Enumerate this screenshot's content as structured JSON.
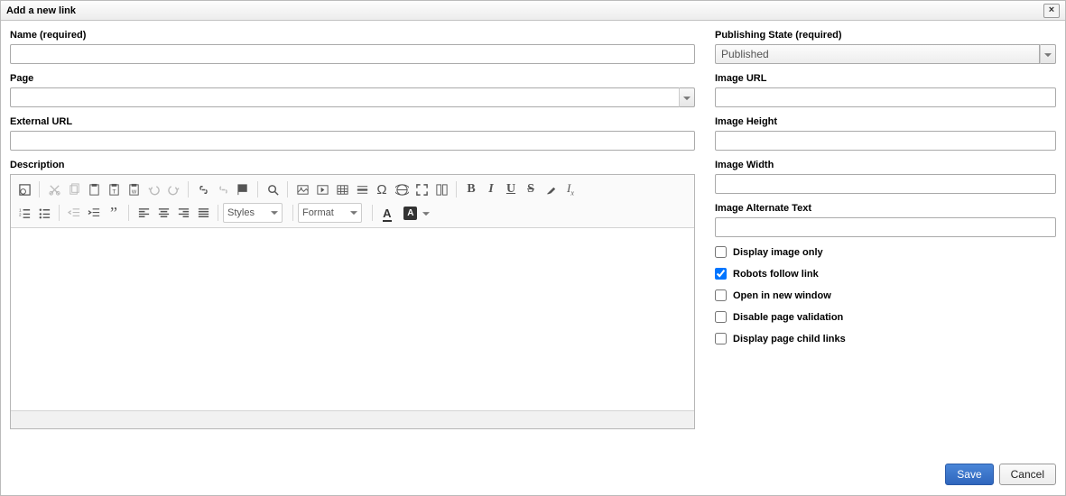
{
  "dialog": {
    "title": "Add a new link",
    "close": "×"
  },
  "left": {
    "name_label": "Name (required)",
    "name_value": "",
    "page_label": "Page",
    "page_value": "",
    "exturl_label": "External URL",
    "exturl_value": "",
    "desc_label": "Description"
  },
  "editor": {
    "styles_label": "Styles",
    "format_label": "Format"
  },
  "right": {
    "pubstate_label": "Publishing State (required)",
    "pubstate_value": "Published",
    "imgurl_label": "Image URL",
    "imgurl_value": "",
    "imgh_label": "Image Height",
    "imgh_value": "",
    "imgw_label": "Image Width",
    "imgw_value": "",
    "imgalt_label": "Image Alternate Text",
    "imgalt_value": "",
    "chk_imgonly": "Display image only",
    "chk_robots": "Robots follow link",
    "chk_newwin": "Open in new window",
    "chk_disval": "Disable page validation",
    "chk_child": "Display page child links"
  },
  "footer": {
    "save": "Save",
    "cancel": "Cancel"
  }
}
